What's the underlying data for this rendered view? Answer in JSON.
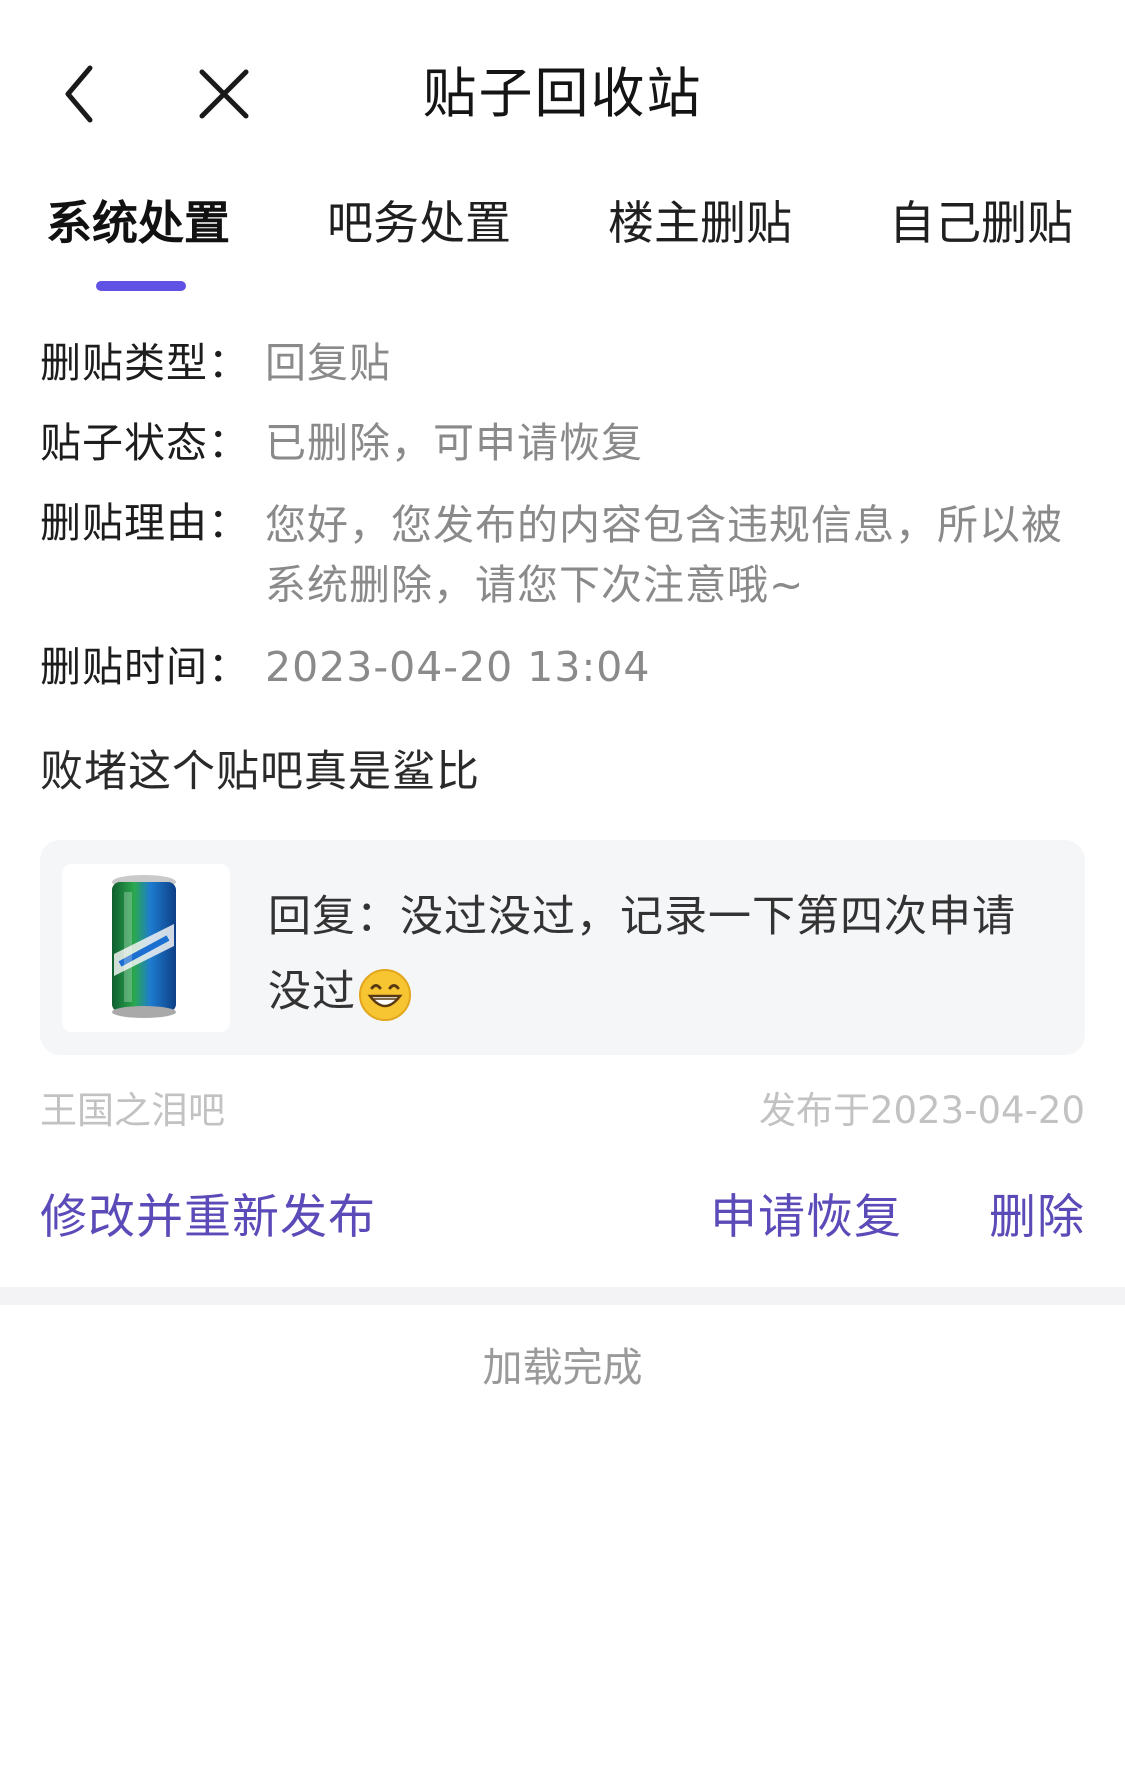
{
  "header": {
    "title": "贴子回收站",
    "back_icon": "chevron-left-icon",
    "close_icon": "close-icon"
  },
  "tabs": [
    {
      "label": "系统处置",
      "active": true
    },
    {
      "label": "吧务处置",
      "active": false
    },
    {
      "label": "楼主删贴",
      "active": false
    },
    {
      "label": "自己删贴",
      "active": false
    }
  ],
  "info": {
    "type_label": "删贴类型：",
    "type_value": "回复贴",
    "status_label": "贴子状态：",
    "status_value": "已删除，可申请恢复",
    "reason_label": "删贴理由：",
    "reason_value": "您好，您发布的内容包含违规信息，所以被系统删除，请您下次注意哦~",
    "time_label": "删贴时间：",
    "time_value": "2023-04-20 13:04"
  },
  "post": {
    "title": "败堵这个贴吧真是鲨比",
    "reply_text": "回复：没过没过，记录一下第四次申请没过",
    "thumbnail_icon": "soda-can-image",
    "emoji_icon": "grinning-face-emoji"
  },
  "meta": {
    "forum": "王国之泪吧",
    "published": "发布于2023-04-20"
  },
  "actions": {
    "edit": "修改并重新发布",
    "restore": "申请恢复",
    "delete": "删除"
  },
  "footer": "加载完成",
  "colors": {
    "accent": "#6152e6",
    "action_text": "#5b4bb8",
    "muted": "#8a8a8a",
    "card_bg": "#f5f6f8"
  }
}
